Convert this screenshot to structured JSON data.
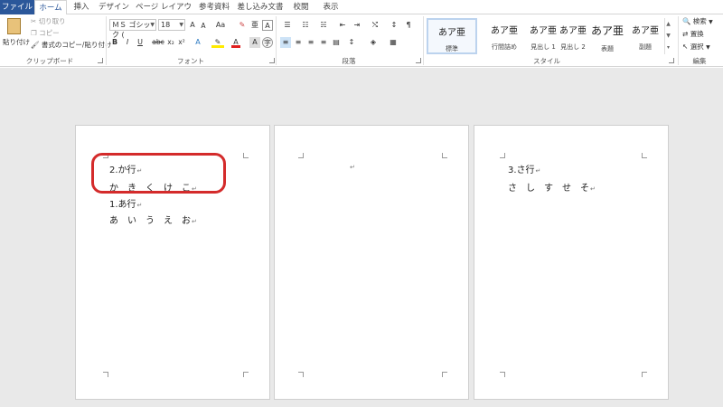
{
  "tabs": [
    "ファイル",
    "ホーム",
    "挿入",
    "デザイン",
    "ページ レイアウト",
    "参考資料",
    "差し込み文書",
    "校閲",
    "表示"
  ],
  "clipboard": {
    "paste": "貼り付け",
    "cut": "切り取り",
    "copy": "コピー",
    "format_painter": "書式のコピー/貼り付け",
    "label": "クリップボード"
  },
  "font": {
    "name": "ＭＳ ゴシック (",
    "size": "18",
    "grow": "A",
    "shrink": "A",
    "case": "Aa",
    "bold": "B",
    "italic": "I",
    "underline": "U",
    "strike": "abc",
    "sub": "x₂",
    "sup": "x²",
    "label": "フォント"
  },
  "paragraph": {
    "label": "段落"
  },
  "styles": {
    "items": [
      {
        "sample": "あア亜",
        "name": "標準"
      },
      {
        "sample": "あア亜",
        "name": "行間詰め"
      },
      {
        "sample": "あア亜",
        "name": "見出し 1"
      },
      {
        "sample": "あア亜",
        "name": "見出し 2"
      },
      {
        "sample": "あア亜",
        "name": "表題"
      },
      {
        "sample": "あア亜",
        "name": "副題"
      }
    ],
    "label": "スタイル"
  },
  "editing": {
    "find": "検索",
    "replace": "置換",
    "select": "選択",
    "label": "編集"
  },
  "pages": [
    {
      "lines": [
        "2.か行",
        "か　き　く　け　こ",
        "1.あ行",
        "あ　い　う　え　お"
      ]
    },
    {
      "lines": [
        ""
      ]
    },
    {
      "lines": [
        "3.さ行",
        "さ　し　す　せ　そ"
      ]
    }
  ],
  "para_mark": "↵",
  "colors": {
    "file_tab": "#2b579a",
    "highlight": "#d42b2b"
  }
}
